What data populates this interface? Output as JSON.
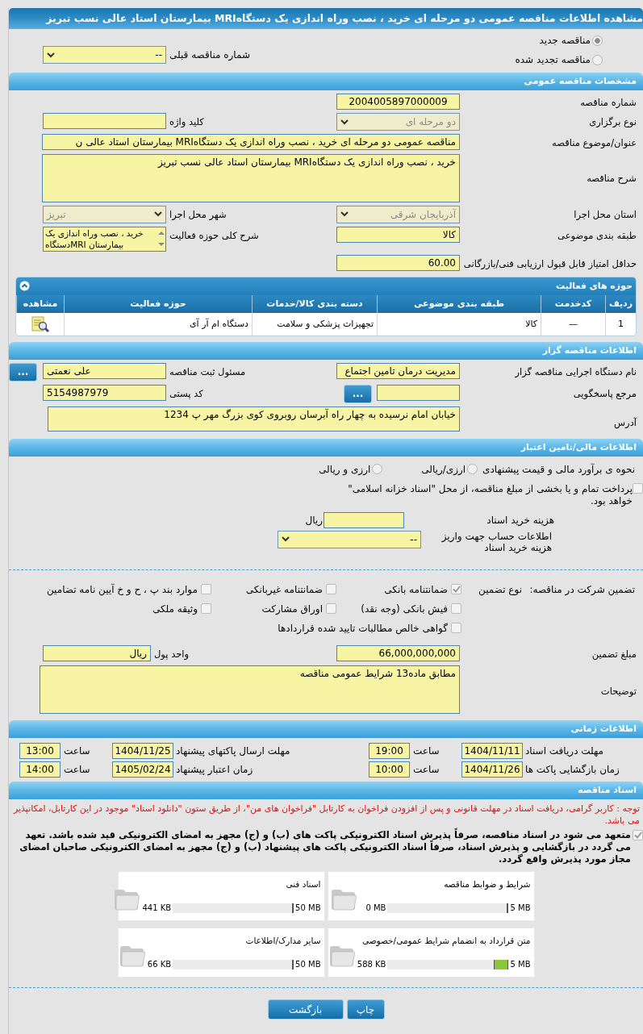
{
  "page_title": "مشاهده اطلاعات مناقصه عمومی دو مرحله ای خرید ، نصب وراه اندازی یک دستگاهMRI بیمارستان استاد عالی نسب تبریز",
  "tender_status": [
    {
      "label": "مناقصه جدید",
      "selected": true
    },
    {
      "label": "مناقصه تجدید شده",
      "selected": false
    }
  ],
  "previous_tender": {
    "label": "شماره مناقصه قبلی",
    "value": "--"
  },
  "general": {
    "title": "مشخصات مناقصه عمومی",
    "rows": [
      {
        "right": {
          "label": "شماره مناقصه",
          "kind": "text",
          "value": "2004005897000009"
        }
      },
      {
        "right": {
          "label": "نوع برگزاری",
          "kind": "select",
          "value": "دو مرحله ای",
          "disabled": true
        },
        "left": {
          "label": "کلید واژه",
          "kind": "text"
        }
      },
      {
        "right": {
          "label": "عنوان/موضوع مناقصه",
          "kind": "longtext",
          "value": "مناقصه عمومی دو مرحله ای خرید ، نصب وراه اندازی یک دستگاهMRI بیمارستان استاد عالی ن"
        }
      },
      {
        "right": {
          "label": "شرح مناقصه",
          "kind": "textarea",
          "value": "خرید ، نصب وراه اندازی یک دستگاهMRI بیمارستان استاد عالی نسب تبریز"
        }
      },
      {
        "right": {
          "label": "استان محل اجرا",
          "kind": "select",
          "value": "آذربایجان شرقی",
          "disabled": true
        },
        "left": {
          "label": "شهر محل اجرا",
          "kind": "select",
          "value": "تبریز",
          "disabled": true
        }
      },
      {
        "right": {
          "label": "طبقه بندی موضوعی",
          "kind": "text",
          "value": "کالا"
        },
        "left": {
          "label": "شرح کلی حوزه فعالیت",
          "kind": "listbox",
          "value": "خرید ، نصب وراه اندازی یک دستگاهMRI بیمارستان"
        }
      },
      {
        "right": {
          "label": "حداقل امتیاز قابل قبول ارزیابی فنی/بازرگانی",
          "kind": "text",
          "value": "60.00"
        }
      }
    ]
  },
  "activities": {
    "title": "حوزه های فعالیت",
    "columns": [
      "ردیف",
      "کدخدمت",
      "طبقه بندی موضوعی",
      "دسته بندی کالا/خدمات",
      "حوزه فعالیت",
      "مشاهده"
    ],
    "rows": [
      {
        "cells": [
          "1",
          "—",
          "کالا",
          "تجهیزات پزشکی و سلامت",
          "دستگاه ام آر آی"
        ]
      }
    ]
  },
  "organizer": {
    "title": "اطلاعات مناقصه گزار",
    "rows": [
      {
        "right": {
          "label": "نام دستگاه اجرایی مناقصه گزار",
          "kind": "text",
          "value": "مدیریت درمان تامین اجتماع"
        },
        "left": {
          "label": "مسئول ثبت مناقصه",
          "kind": "text",
          "value": "علی نعمتی",
          "button": "..."
        }
      },
      {
        "right": {
          "label": "مرجع پاسخگویی",
          "kind": "text",
          "button": "..."
        },
        "left": {
          "label": "کد پستی",
          "kind": "text",
          "value": "5154987979"
        }
      },
      {
        "right": {
          "label": "آدرس",
          "kind": "address",
          "value": "خیابان امام نرسیده به چهار راه آبرسان روبروی کوی بزرگ مهر پ 1234"
        }
      }
    ]
  },
  "financial": {
    "title": "اطلاعات مالی/تامین اعتبار",
    "estimate": {
      "label": "نحوه ی برآورد مالی و قیمت پیشنهادی",
      "options": [
        {
          "label": "ارزی/ریالی",
          "selected": false
        },
        {
          "label": "ارزی و ریالی",
          "selected": false
        }
      ]
    },
    "treasury": {
      "label": "پرداخت تمام و یا بخشی از مبلغ مناقصه، از محل \"اسناد خزانه اسلامی\" خواهد بود.",
      "checked": false
    },
    "document_fee": {
      "label": "هزینه خرید اسناد",
      "unit": "ریال"
    },
    "fee_account": {
      "label": "اطلاعات حساب جهت واریز هزینه خرید اسناد",
      "value": "--"
    }
  },
  "guarantee": {
    "label": "تضمین شرکت در مناقصه:",
    "type_label": "نوع تضمین",
    "options": [
      {
        "label": "ضمانتنامه بانکی",
        "checked": true
      },
      {
        "label": "ضمانتنامه غیربانکی",
        "checked": false
      },
      {
        "label": "موارد بند پ ، ح و خ آیین نامه تضامین",
        "checked": false
      },
      {
        "label": "فیش بانکی (وجه نقد)",
        "checked": false
      },
      {
        "label": "اوراق مشارکت",
        "checked": false
      },
      {
        "label": "وثیقه ملکی",
        "checked": false
      },
      {
        "label": "گواهی خالص مطالبات تایید شده قراردادها",
        "checked": false
      }
    ],
    "amount": {
      "label": "مبلغ تضمین",
      "value": "66,000,000,000"
    },
    "currency": {
      "label": "واحد پول",
      "value": "ریال"
    },
    "description": {
      "label": "توضیحات",
      "value": "مطابق ماده13 شرایط عمومی مناقصه"
    }
  },
  "timing": {
    "title": "اطلاعات زمانی",
    "items": [
      {
        "label": "مهلت دریافت اسناد",
        "date": "1404/11/11",
        "time_label": "ساعت",
        "time": "19:00"
      },
      {
        "label": "مهلت ارسال پاکتهای پیشنهاد",
        "date": "1404/11/25",
        "time_label": "ساعت",
        "time": "13:00"
      },
      {
        "label": "زمان بازگشایی پاکت ها",
        "date": "1404/11/26",
        "time_label": "ساعت",
        "time": "10:00"
      },
      {
        "label": "زمان اعتبار پیشنهاد",
        "date": "1405/02/24",
        "time_label": "ساعت",
        "time": "14:00"
      }
    ]
  },
  "documents": {
    "title": "اسناد مناقصه",
    "notice": "توجه : کاربر گرامی، دریافت اسناد در مهلت قانونی و پس از افزودن فراخوان به کارتابل \"فراخوان های من\"، از طریق ستون \"دانلود اسناد\" موجود در این کارتابل، امکانپذیر می باشد.",
    "commitment": {
      "text": "متعهد می شود در اسناد مناقصه، صرفاً پذیرش اسناد الکترونیکی پاکت های (ب) و (ج) مجهز به امضای الکترونیکی قید شده باشد. تعهد می گردد در بازگشایی و پذیرش اسناد، صرفاً اسناد الکترونیکی پاکت های پیشنهاد (ب) و (ج) مجهز به امضای الکترونیکی صاحبان امضای مجاز مورد پذیرش واقع گردد.",
      "checked": true
    },
    "files": [
      {
        "title": "شرایط و ضوابط مناقصه",
        "size": "0 MB",
        "limit": "5 MB",
        "level": 0
      },
      {
        "title": "اسناد فنی",
        "size": "441 KB",
        "limit": "50 MB",
        "level": 0.01
      },
      {
        "title": "متن قرارداد به انضمام شرایط عمومی/خصوصی",
        "size": "588 KB",
        "limit": "5 MB",
        "level": 0.12
      },
      {
        "title": "سایر مدارک/اطلاعات",
        "size": "66 KB",
        "limit": "50 MB",
        "level": 0.01
      }
    ]
  },
  "buttons": [
    {
      "label": "چاپ"
    },
    {
      "label": "بازگشت"
    }
  ]
}
